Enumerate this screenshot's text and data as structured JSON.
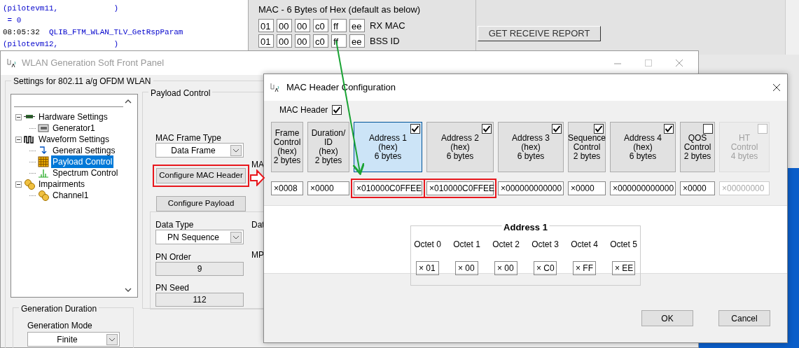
{
  "log": {
    "lines": [
      {
        "text": "(pilotevm11,            )"
      },
      {
        "text": " = 0"
      },
      {
        "time": "08:05:32",
        "text": "QLIB_FTM_WLAN_TLV_GetRspParam"
      },
      {
        "text": "(pilotevm12,            )"
      }
    ]
  },
  "mac_panel": {
    "title": "MAC - 6 Bytes of Hex (default as below)",
    "rows": [
      {
        "label": "RX MAC",
        "bytes": [
          "01",
          "00",
          "00",
          "c0",
          "ff",
          "ee"
        ]
      },
      {
        "label": "BSS ID",
        "bytes": [
          "01",
          "00",
          "00",
          "c0",
          "ff",
          "ee"
        ]
      }
    ]
  },
  "report_button": "GET RECEIVE REPORT",
  "main_window": {
    "title": "WLAN Generation Soft Front Panel",
    "group_title": "Settings for 802.11 a/g OFDM WLAN",
    "tree": [
      {
        "label": "Hardware Settings",
        "kind": "board",
        "expanded": true,
        "selected": false,
        "children": [
          {
            "label": "Generator1",
            "kind": "generator",
            "selected": false
          }
        ]
      },
      {
        "label": "Waveform Settings",
        "kind": "wave",
        "expanded": true,
        "selected": false,
        "children": [
          {
            "label": "General Settings",
            "kind": "arrow",
            "selected": false
          },
          {
            "label": "Payload Control",
            "kind": "grid",
            "selected": true
          },
          {
            "label": "Spectrum Control",
            "kind": "spectrum",
            "selected": false
          }
        ]
      },
      {
        "label": "Impairments",
        "kind": "gears",
        "expanded": true,
        "selected": false,
        "children": [
          {
            "label": "Channel1",
            "kind": "gears",
            "selected": false
          }
        ]
      }
    ],
    "duration": {
      "title": "Generation Duration",
      "mode_label": "Generation Mode",
      "mode_value": "Finite"
    },
    "payload": {
      "title": "Payload Control",
      "frame_type_label": "MAC Frame Type",
      "frame_type_value": "Data Frame",
      "cut_label": "MA",
      "buttons": [
        {
          "label": "Configure MAC Header",
          "highlighted": true
        },
        {
          "label": "Configure Payload",
          "highlighted": false
        }
      ],
      "data_type_label": "Data Type",
      "data_type_value": "PN Sequence",
      "cut_label_2": "Dat",
      "pn_order_label": "PN Order",
      "pn_order_value": "9",
      "cut_label_3": "MP",
      "pn_seed_label": "PN Seed",
      "pn_seed_value": "112"
    }
  },
  "dialog": {
    "title": "MAC Header Configuration",
    "mac_header_label": "MAC Header",
    "mac_header_checked": true,
    "fields": [
      {
        "label": "Frame\nControl\n(hex)\n2 bytes",
        "disabled": false,
        "selected": false,
        "value": "×0008",
        "highlighted": false
      },
      {
        "label": "Duration/\nID\n(hex)\n2 bytes",
        "disabled": false,
        "selected": false,
        "value": "×0000",
        "highlighted": false
      },
      {
        "label": "Address 1\n(hex)\n6 bytes",
        "checked": true,
        "disabled": false,
        "selected": true,
        "value": "×010000C0FFEE",
        "highlighted": true
      },
      {
        "label": "Address 2\n(hex)\n6 bytes",
        "checked": true,
        "disabled": false,
        "selected": false,
        "value": "×010000C0FFEE",
        "highlighted": true
      },
      {
        "label": "Address 3\n(hex)\n6 bytes",
        "checked": true,
        "disabled": false,
        "selected": false,
        "value": "×000000000000",
        "highlighted": false
      },
      {
        "label": "Sequence\nControl\n2 bytes",
        "checked": true,
        "disabled": false,
        "selected": false,
        "value": "×0000",
        "highlighted": false
      },
      {
        "label": "Address 4\n(hex)\n6 bytes",
        "checked": true,
        "disabled": false,
        "selected": false,
        "value": "×000000000000",
        "highlighted": false
      },
      {
        "label": "QOS\nControl\n2 bytes",
        "checked": false,
        "disabled": false,
        "selected": false,
        "value": "×0000",
        "highlighted": false
      },
      {
        "label": "HT\nControl\n4 bytes",
        "checked": false,
        "disabled": true,
        "selected": false,
        "value": "×00000000",
        "highlighted": false
      }
    ],
    "address": {
      "title": "Address 1",
      "octets": [
        {
          "label": "Octet 0",
          "value": "× 01"
        },
        {
          "label": "Octet 1",
          "value": "× 00"
        },
        {
          "label": "Octet 2",
          "value": "× 00"
        },
        {
          "label": "Octet 3",
          "value": "× C0"
        },
        {
          "label": "Octet 4",
          "value": "× FF"
        },
        {
          "label": "Octet 5",
          "value": "× EE"
        }
      ]
    },
    "buttons": [
      "OK",
      "Cancel"
    ]
  }
}
